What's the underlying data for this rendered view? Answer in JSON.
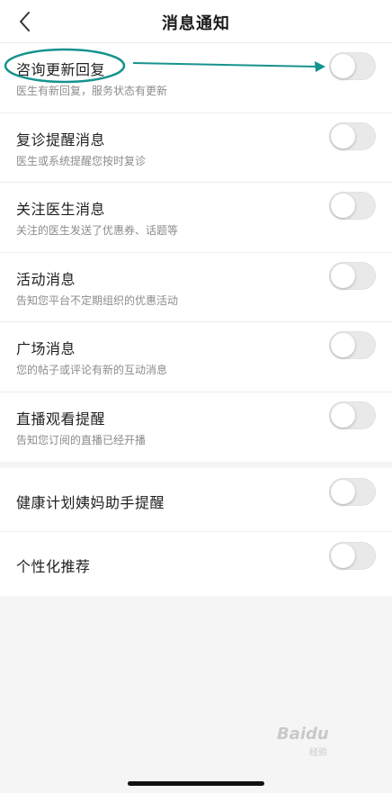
{
  "navbar": {
    "title": "消息通知",
    "back_icon": "chevron-left-icon"
  },
  "group1": [
    {
      "title": "咨询更新回复",
      "desc": "医生有新回复，服务状态有更新",
      "enabled": false
    },
    {
      "title": "复诊提醒消息",
      "desc": "医生或系统提醒您按时复诊",
      "enabled": false
    },
    {
      "title": "关注医生消息",
      "desc": "关注的医生发送了优惠券、话题等",
      "enabled": false
    },
    {
      "title": "活动消息",
      "desc": "告知您平台不定期组织的优惠活动",
      "enabled": false
    },
    {
      "title": "广场消息",
      "desc": "您的帖子或评论有新的互动消息",
      "enabled": false
    },
    {
      "title": "直播观看提醒",
      "desc": "告知您订阅的直播已经开播",
      "enabled": false
    }
  ],
  "group2": [
    {
      "title": "健康计划姨妈助手提醒",
      "enabled": false
    },
    {
      "title": "个性化推荐",
      "enabled": false
    }
  ],
  "watermark": {
    "text": "Baidu",
    "sub": "经验"
  },
  "colors": {
    "annotation": "#16938d",
    "toggle_off": "#e9e9e9",
    "background": "#f5f5f5"
  }
}
